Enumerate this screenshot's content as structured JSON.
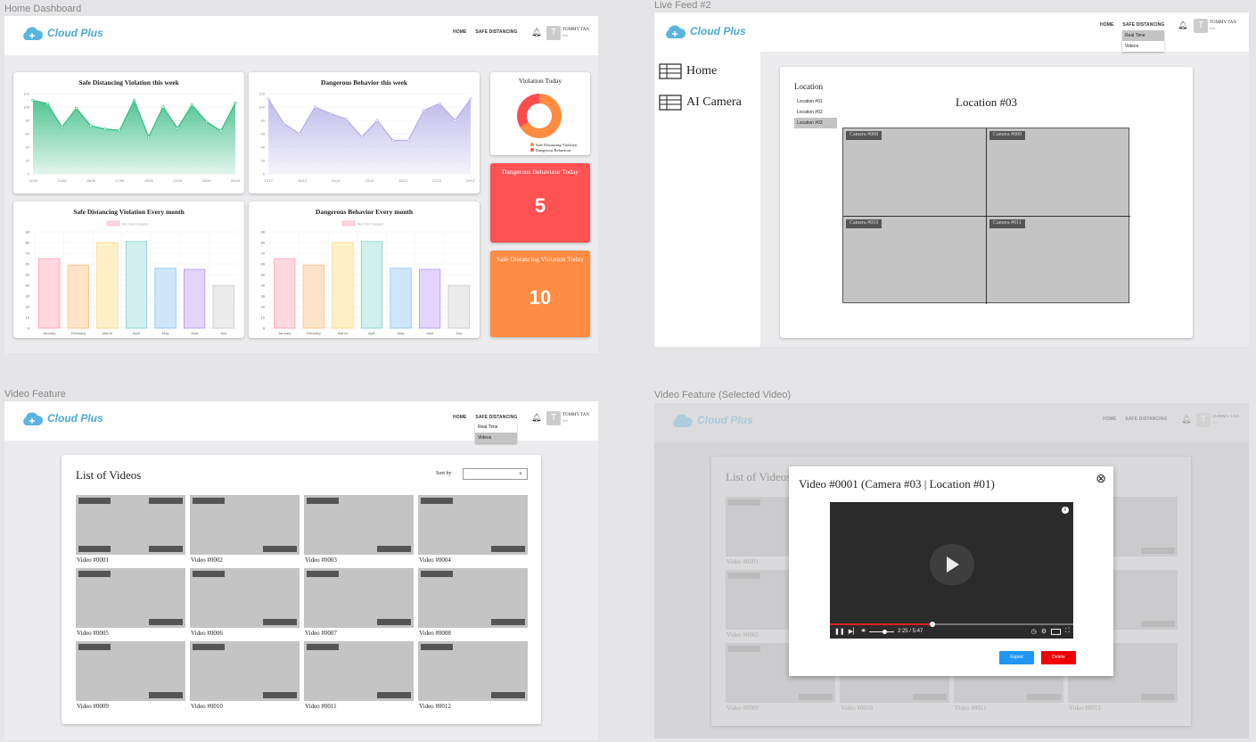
{
  "frames": {
    "home": "Home Dashboard",
    "live": "Live Feed #2",
    "video": "Video Feature",
    "selected": "Video Feature (Selected Video)"
  },
  "header": {
    "brand": "Cloud Plus",
    "nav_home": "HOME",
    "nav_safe": "SAFE DISTANCING",
    "user_name": "TOMMY TAN",
    "user_sub": "Sub",
    "avatar_letter": "T",
    "dropdown": [
      "Real Time",
      "Videos"
    ]
  },
  "dashboard": {
    "chart1_title": "Safe Distancing Violation this week",
    "chart2_title": "Dangerous Behavior this week",
    "chart3_title": "Safe Distancing Violation Every month",
    "chart4_title": "Dangerous Behavior Every month",
    "donut_title": "Violation Today",
    "legend_safe": "Safe Distancing Violation",
    "legend_danger": "Dangerous Behaviour",
    "danger_today_title": "Dangerous Behaviour Today",
    "danger_today_value": "5",
    "safe_today_title": "Safe Distancing Violation Today",
    "safe_today_value": "10",
    "bar_legend": "My First Dataset"
  },
  "chart_data": [
    {
      "type": "area",
      "title": "Safe Distancing Violation this week",
      "x": [
        "11/05",
        "",
        "13/05",
        "",
        "15/05",
        "",
        "17/05",
        "",
        "19/05",
        "",
        "21/05",
        "",
        "23/05",
        "",
        "25/05"
      ],
      "values": [
        110,
        105,
        70,
        98,
        72,
        67,
        65,
        110,
        55,
        100,
        68,
        103,
        78,
        64,
        106
      ],
      "ylim": [
        0,
        120
      ],
      "yticks": [
        0,
        20,
        40,
        60,
        80,
        100,
        120
      ],
      "color": "#3fbf86"
    },
    {
      "type": "area",
      "title": "Dangerous Behavior this week",
      "x": [
        "17/12",
        "",
        "19/12",
        "",
        "21/12",
        "",
        "23/12",
        "",
        "25/12",
        "",
        "27/12",
        "",
        "29/12"
      ],
      "values": [
        112,
        75,
        60,
        100,
        90,
        82,
        55,
        80,
        50,
        50,
        95,
        105,
        80,
        112
      ],
      "ylim": [
        0,
        120
      ],
      "yticks": [
        0,
        20,
        40,
        60,
        80,
        100,
        120
      ],
      "color": "#b8b4e8"
    },
    {
      "type": "bar",
      "title": "Safe Distancing Violation Every month",
      "categories": [
        "January",
        "February",
        "March",
        "April",
        "May",
        "June",
        "July"
      ],
      "values": [
        65,
        59,
        80,
        81,
        56,
        55,
        40
      ],
      "ylim": [
        0,
        90
      ],
      "legend": "My First Dataset"
    },
    {
      "type": "bar",
      "title": "Dangerous Behavior Every month",
      "categories": [
        "January",
        "February",
        "March",
        "April",
        "May",
        "June",
        "July"
      ],
      "values": [
        65,
        59,
        80,
        81,
        56,
        55,
        40
      ],
      "ylim": [
        0,
        90
      ],
      "legend": "My First Dataset"
    },
    {
      "type": "pie",
      "title": "Violation Today",
      "labels": [
        "Safe Distancing Violation",
        "Dangerous Behaviour"
      ],
      "values": [
        10,
        5
      ],
      "colors": [
        "#ff8c42",
        "#ff4d4d"
      ]
    }
  ],
  "bar_colors": [
    "#ffd7df",
    "#ffe3c8",
    "#fff0c8",
    "#d2eeee",
    "#cfe6fa",
    "#e2d4fb",
    "#ececec"
  ],
  "bar_borders": [
    "#ff9eb0",
    "#ffbf80",
    "#ffd77a",
    "#7fcfcf",
    "#8cc4f0",
    "#b595f5",
    "#c9c9cb"
  ],
  "live": {
    "side_home": "Home",
    "side_camera": "AI Camera",
    "location_label": "Location",
    "locations": [
      "Location #01",
      "Location #02",
      "Location #03"
    ],
    "title": "Location #03",
    "cameras": [
      "Camera #008",
      "Camera #009",
      "Camera #010",
      "Camera #011"
    ]
  },
  "videos": {
    "title": "List of Videos",
    "sort_label": "Sort by",
    "items": [
      "Video #0001",
      "Video #0002",
      "Video #0003",
      "Video #0004",
      "Video #0005",
      "Video #0006",
      "Video #0007",
      "Video #0008",
      "Video #0009",
      "Video #0010",
      "Video #0011",
      "Video #0012"
    ]
  },
  "modal": {
    "title": "Video #0001 (Camera #03 | Location #01)",
    "time": "2:25 / 5:47",
    "progress": 0.42,
    "export": "Export",
    "delete": "Delete"
  }
}
